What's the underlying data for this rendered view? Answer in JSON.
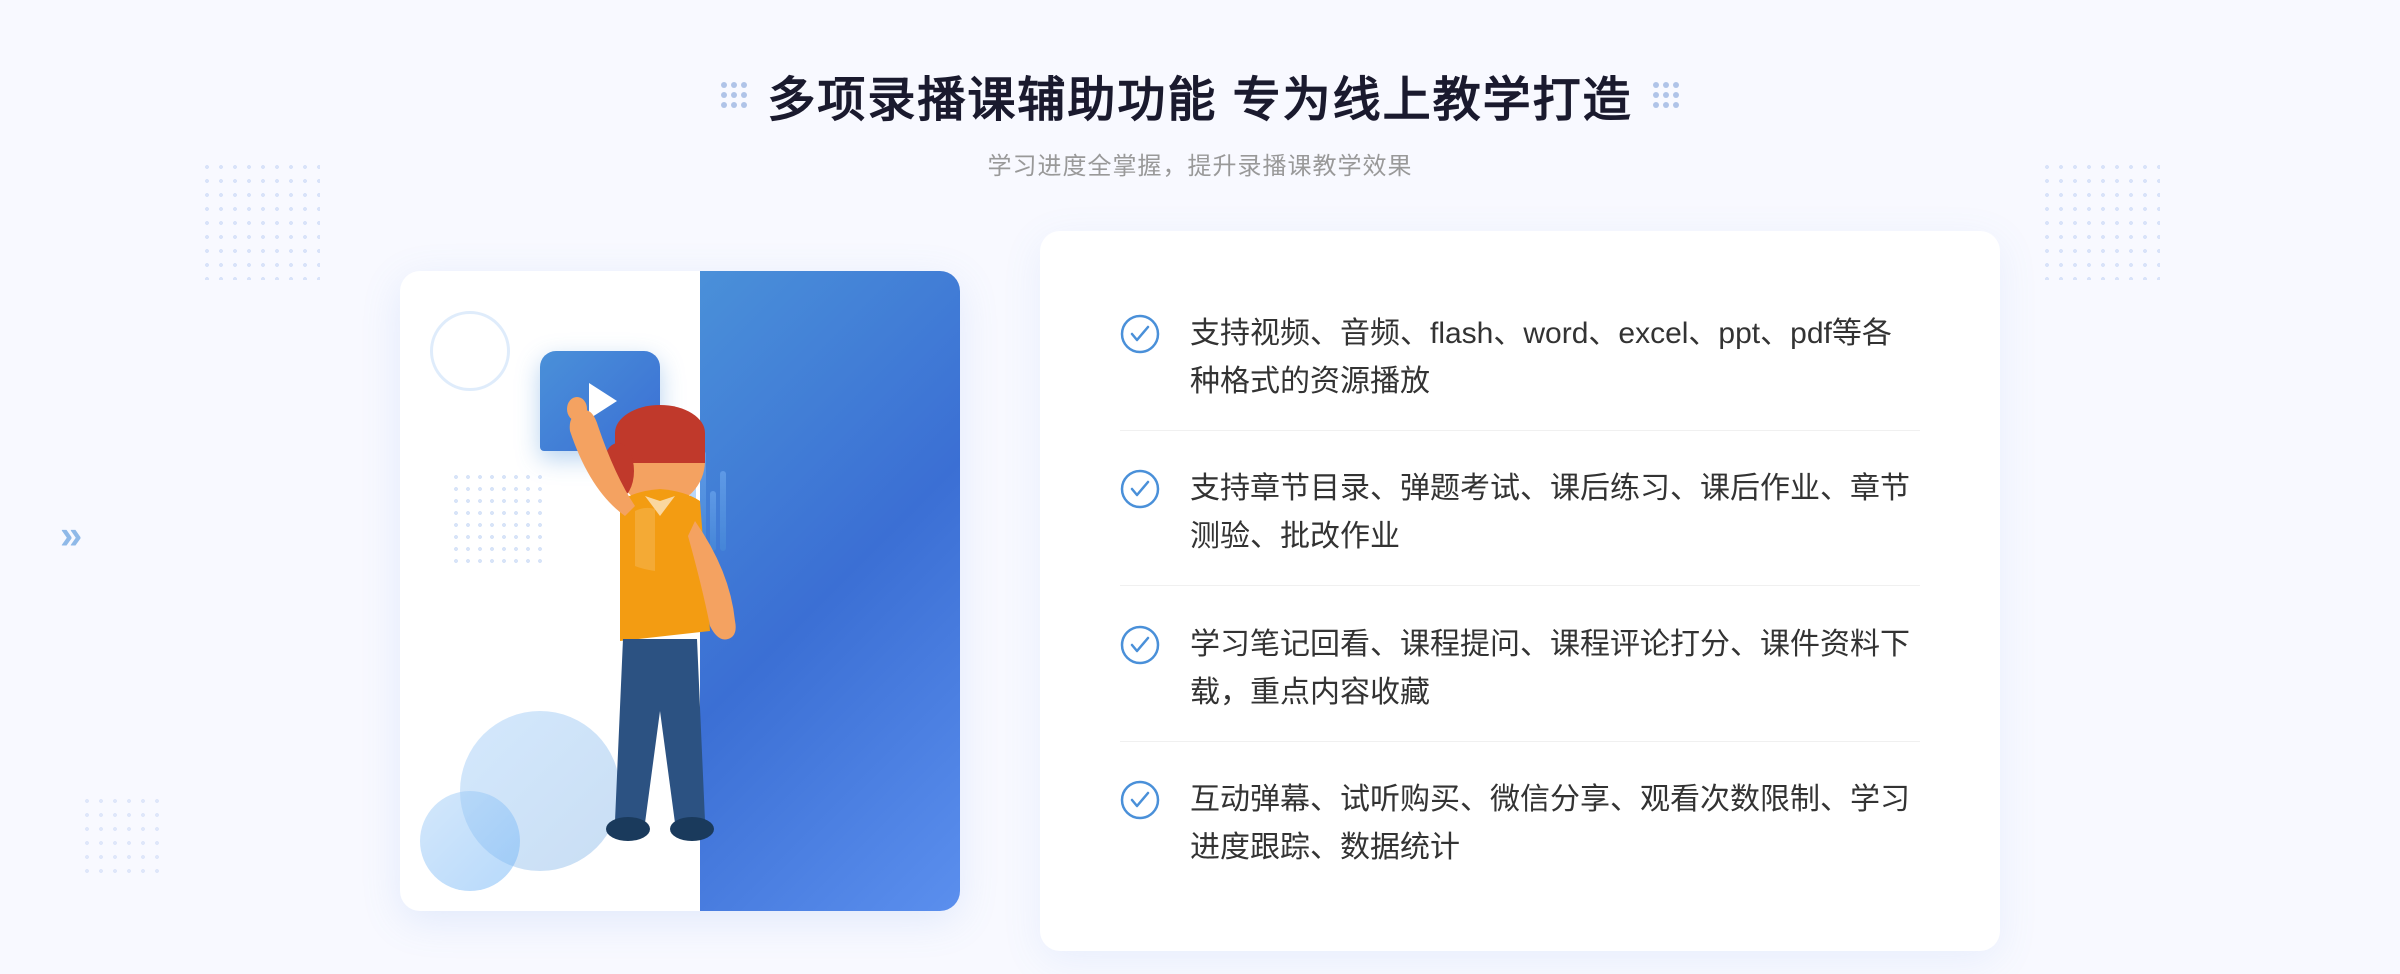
{
  "header": {
    "main_title": "多项录播课辅助功能 专为线上教学打造",
    "sub_title": "学习进度全掌握，提升录播课教学效果"
  },
  "features": [
    {
      "id": 1,
      "text": "支持视频、音频、flash、word、excel、ppt、pdf等各种格式的资源播放"
    },
    {
      "id": 2,
      "text": "支持章节目录、弹题考试、课后练习、课后作业、章节测验、批改作业"
    },
    {
      "id": 3,
      "text": "学习笔记回看、课程提问、课程评论打分、课件资料下载，重点内容收藏"
    },
    {
      "id": 4,
      "text": "互动弹幕、试听购买、微信分享、观看次数限制、学习进度跟踪、数据统计"
    }
  ],
  "icons": {
    "check": "check-circle-icon",
    "play": "play-icon",
    "dots_left": "decorative-dots-left",
    "dots_right": "decorative-dots-right",
    "left_arrow": "left-arrow-icon"
  },
  "colors": {
    "primary": "#4a90d9",
    "primary_dark": "#3b6fd4",
    "text_dark": "#1a1a2e",
    "text_medium": "#333333",
    "text_light": "#999999",
    "bg_light": "#f8f9ff",
    "accent": "#5b8fee"
  }
}
